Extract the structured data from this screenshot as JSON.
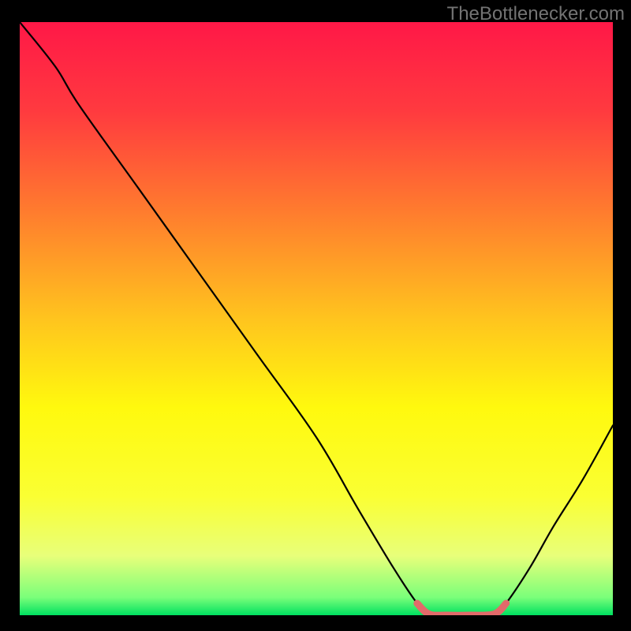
{
  "attribution": "TheBottlenecker.com",
  "chart_data": {
    "type": "line",
    "title": "",
    "xlabel": "",
    "ylabel": "",
    "xlim": [
      0,
      100
    ],
    "ylim": [
      0,
      100
    ],
    "gradient_stops": [
      {
        "pos": 0.0,
        "color": "#ff1847"
      },
      {
        "pos": 0.15,
        "color": "#ff3a3f"
      },
      {
        "pos": 0.32,
        "color": "#ff7c2e"
      },
      {
        "pos": 0.5,
        "color": "#ffc41e"
      },
      {
        "pos": 0.65,
        "color": "#fff90e"
      },
      {
        "pos": 0.8,
        "color": "#faff33"
      },
      {
        "pos": 0.9,
        "color": "#e8ff7a"
      },
      {
        "pos": 0.97,
        "color": "#7aff7a"
      },
      {
        "pos": 1.0,
        "color": "#00e060"
      }
    ],
    "curve": [
      {
        "x": 0,
        "y": 100
      },
      {
        "x": 6,
        "y": 92.5
      },
      {
        "x": 10,
        "y": 86
      },
      {
        "x": 20,
        "y": 72
      },
      {
        "x": 30,
        "y": 58
      },
      {
        "x": 40,
        "y": 44
      },
      {
        "x": 50,
        "y": 30
      },
      {
        "x": 57,
        "y": 18
      },
      {
        "x": 63,
        "y": 8
      },
      {
        "x": 67,
        "y": 2
      },
      {
        "x": 69,
        "y": 0
      },
      {
        "x": 72,
        "y": 0
      },
      {
        "x": 76,
        "y": 0
      },
      {
        "x": 80,
        "y": 0
      },
      {
        "x": 82,
        "y": 2
      },
      {
        "x": 86,
        "y": 8
      },
      {
        "x": 90,
        "y": 15
      },
      {
        "x": 95,
        "y": 23
      },
      {
        "x": 100,
        "y": 32
      }
    ],
    "highlight": [
      {
        "x": 67,
        "y": 2.0
      },
      {
        "x": 69,
        "y": 0.2
      },
      {
        "x": 72,
        "y": 0.0
      },
      {
        "x": 76,
        "y": 0.0
      },
      {
        "x": 80,
        "y": 0.2
      },
      {
        "x": 82,
        "y": 2.0
      }
    ],
    "highlight_color": "#e26a6a"
  }
}
